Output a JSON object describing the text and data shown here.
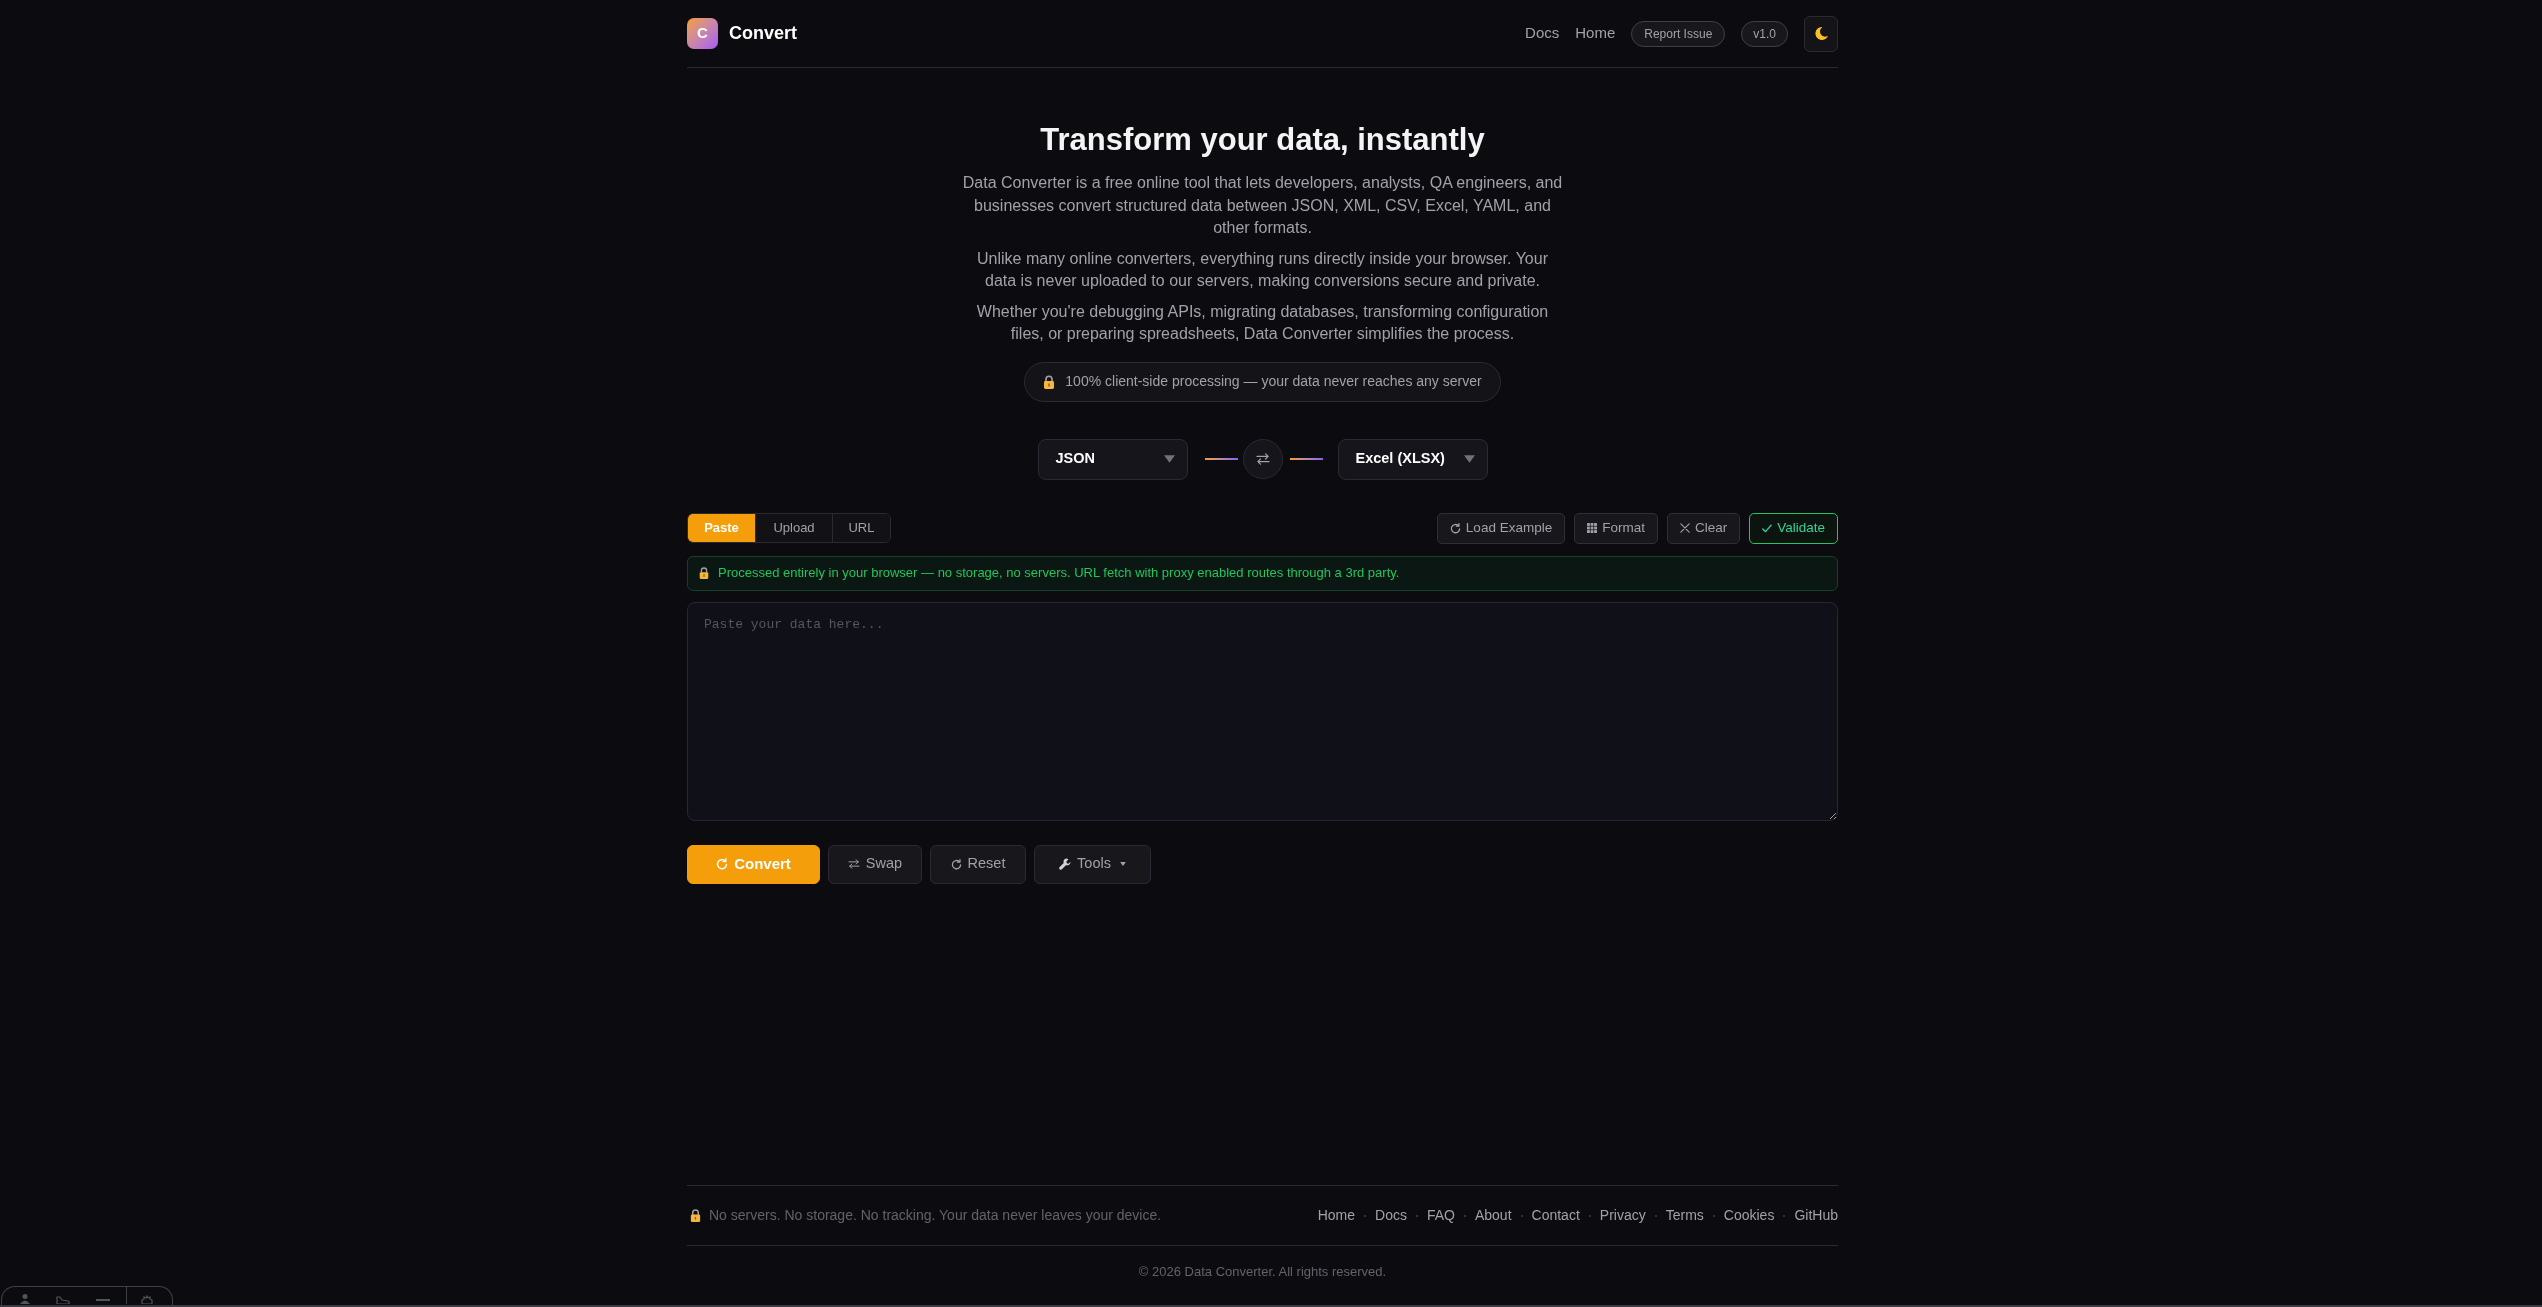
{
  "header": {
    "logo": {
      "letter": "C"
    },
    "brand": "Convert",
    "nav": [
      {
        "label": "Docs"
      },
      {
        "label": "Home"
      }
    ],
    "report_issue": "Report Issue",
    "version": "v1.0"
  },
  "hero": {
    "title": "Transform your data, instantly",
    "paragraphs": [
      "Data Converter is a free online tool that lets developers, analysts, QA engineers, and businesses convert structured data between JSON, XML, CSV, Excel, YAML, and other formats.",
      "Unlike many online converters, everything runs directly inside your browser. Your data is never uploaded to our servers, making conversions secure and private.",
      "Whether you're debugging APIs, migrating databases, transforming configuration files, or preparing spreadsheets, Data Converter simplifies the process."
    ],
    "badge": "100% client-side processing — your data never reaches any server"
  },
  "formats": {
    "from": "JSON",
    "to": "Excel (XLSX)"
  },
  "input_tabs": [
    {
      "label": "Paste",
      "selected": true
    },
    {
      "label": "Upload",
      "selected": false
    },
    {
      "label": "URL",
      "selected": false
    }
  ],
  "toolbar": [
    {
      "label": "Load Example",
      "kind": "load"
    },
    {
      "label": "Format",
      "kind": "format"
    },
    {
      "label": "Clear",
      "kind": "clear"
    },
    {
      "label": "Validate",
      "kind": "validate"
    }
  ],
  "privacy_notice": "Processed entirely in your browser — no storage, no servers. URL fetch with proxy enabled routes through a 3rd party.",
  "editor": {
    "placeholder": "Paste your data here..."
  },
  "actions": [
    {
      "label": "Convert",
      "kind": "convert"
    },
    {
      "label": "Swap",
      "kind": "swap"
    },
    {
      "label": "Reset",
      "kind": "reset"
    },
    {
      "label": "Tools",
      "kind": "tools"
    }
  ],
  "footer": {
    "note": "No servers. No storage. No tracking. Your data never leaves your device.",
    "links": [
      "Home",
      "Docs",
      "FAQ",
      "About",
      "Contact",
      "Privacy",
      "Terms",
      "Cookies",
      "GitHub"
    ],
    "copyright": "© 2026 Data Converter. All rights reserved."
  }
}
